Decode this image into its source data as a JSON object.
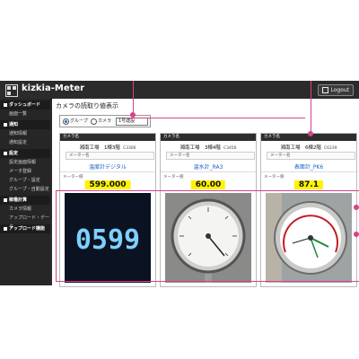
{
  "app": {
    "title": "kizkia-Meter",
    "logout_label": "Logout"
  },
  "sidebar": {
    "sections": [
      {
        "label": "ダッシュボード",
        "items": [
          "画面一覧"
        ]
      },
      {
        "label": "通知",
        "items": [
          "通知情報",
          "通知設定"
        ]
      },
      {
        "label": "設定",
        "items": [
          "設定画面情報",
          "メータ登録",
          "グループ・設定",
          "グループ・自動設定"
        ]
      },
      {
        "label": "稼働計算",
        "items": [
          "カメラ情報",
          "アップロード・データ"
        ]
      },
      {
        "label": "アップロード機能",
        "items": []
      }
    ]
  },
  "main": {
    "page_title": "カメラの読取り値表示",
    "filter": {
      "options": [
        "グループ",
        "カメラ"
      ],
      "selected_value": "1号建設"
    },
    "cards": [
      {
        "header": "カメラ名",
        "title": "湘南工場　1棟3階",
        "code": "C3306",
        "meter_label": "メーター名",
        "meter_name": "温度計デジタル",
        "value_label": "メーター値",
        "value": "599.000",
        "image": "digital"
      },
      {
        "header": "カメラ名",
        "title": "湘南工場　3棟4階",
        "code": "C3456",
        "meter_label": "メーター名",
        "meter_name": "温水計_RA3",
        "value_label": "メーター値",
        "value": "60.00",
        "image": "dial"
      },
      {
        "header": "カメラ名",
        "title": "湘南工場　6棟2階",
        "code": "C6239",
        "meter_label": "メーター名",
        "meter_name": "表面計_PK6",
        "value_label": "メーター値",
        "value": "87.1",
        "image": "pressure"
      }
    ],
    "digital_readout": "0599"
  },
  "colors": {
    "highlight": "#fff200",
    "annotation": "#d6438a",
    "link": "#1a5fc2",
    "header_bg": "#2b2b2b"
  }
}
